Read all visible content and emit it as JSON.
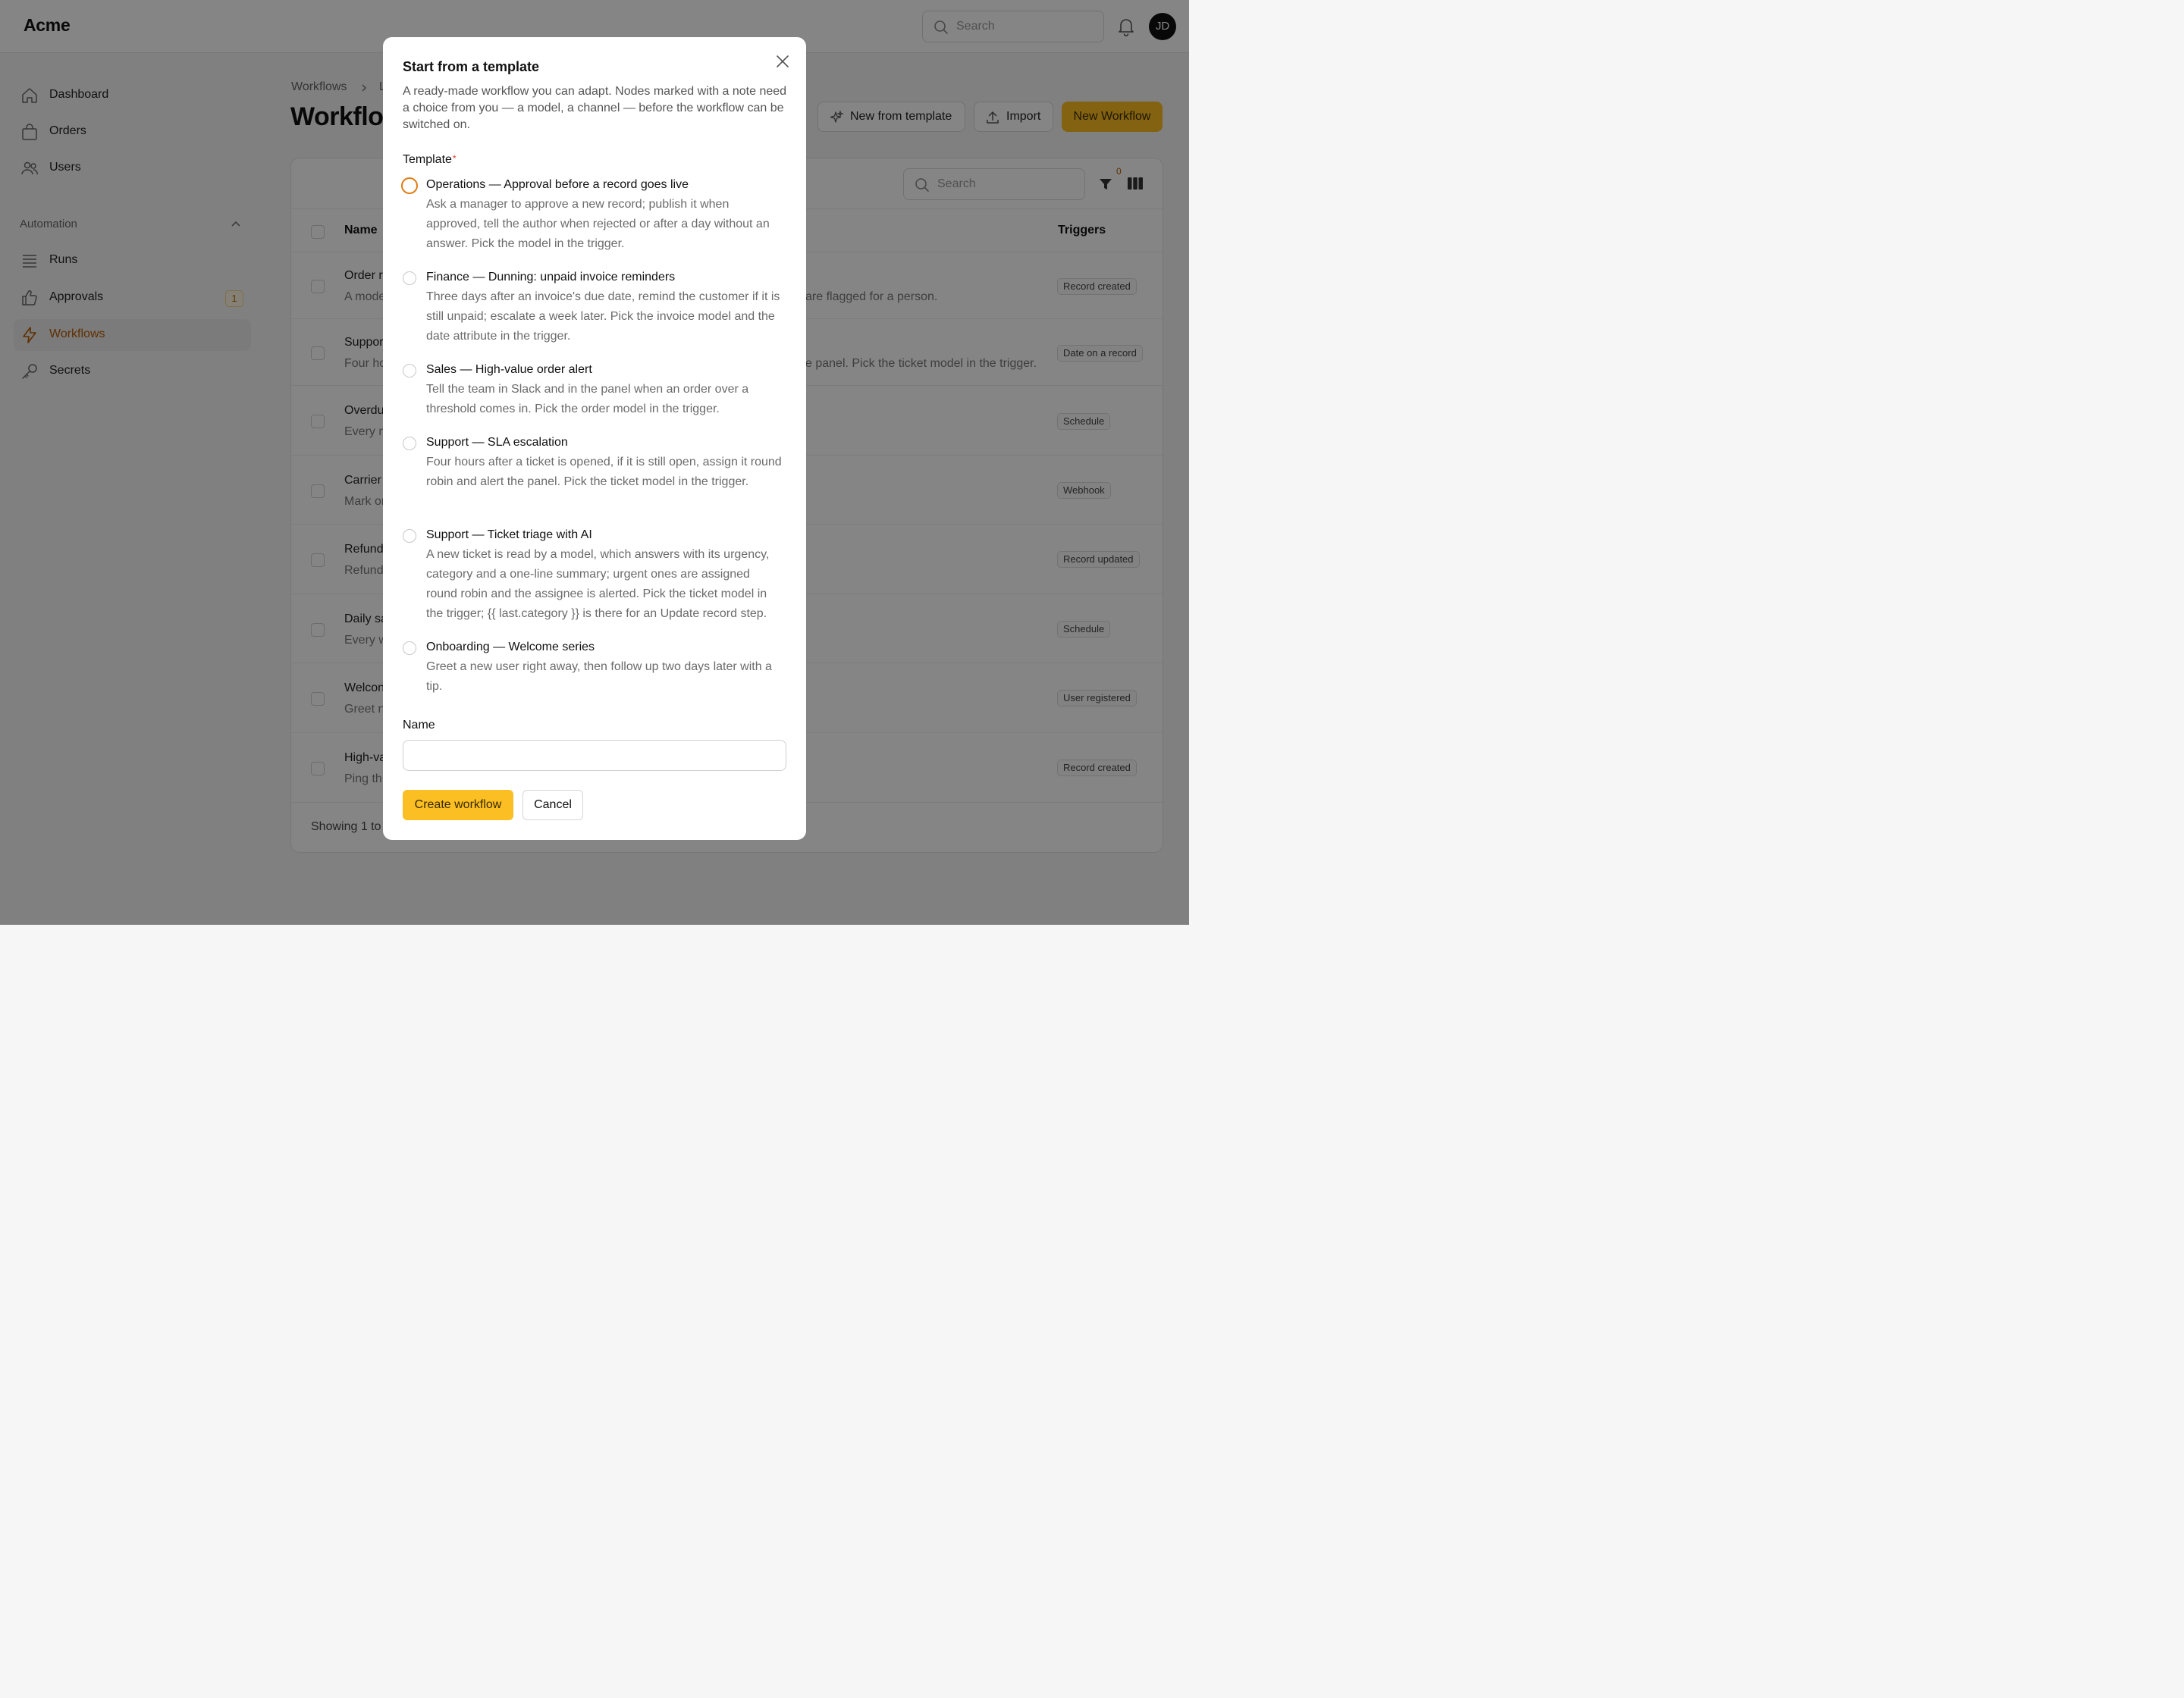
{
  "app": {
    "logo": "Acme"
  },
  "topbar": {
    "search_placeholder": "Search",
    "avatar_initials": "JD"
  },
  "sidebar": {
    "items": [
      {
        "label": "Dashboard",
        "icon": "home-icon"
      },
      {
        "label": "Orders",
        "icon": "shopping-bag-icon"
      },
      {
        "label": "Users",
        "icon": "users-icon"
      }
    ],
    "section": {
      "label": "Automation"
    },
    "automation_items": [
      {
        "label": "Runs",
        "icon": "list-icon"
      },
      {
        "label": "Approvals",
        "icon": "thumbs-up-icon",
        "badge": "1"
      },
      {
        "label": "Workflows",
        "icon": "lightning-icon",
        "active": true
      },
      {
        "label": "Secrets",
        "icon": "key-icon"
      }
    ]
  },
  "main": {
    "breadcrumb": [
      "Workflows",
      "L"
    ],
    "title": "Workflo",
    "buttons": {
      "new_from_template": "New from template",
      "import": "Import",
      "new_workflow": "New Workflow"
    },
    "table": {
      "search_placeholder": "Search",
      "filter_count": "0",
      "headers": {
        "name": "Name",
        "triggers": "Triggers"
      },
      "rows": [
        {
          "name": "Order r",
          "desc": "A mode",
          "desc_tail": "are flagged for a person.",
          "trigger": "Record created"
        },
        {
          "name": "Suppor",
          "desc": "Four ho",
          "desc_tail": "e panel. Pick the ticket model in the trigger.",
          "trigger": "Date on a record"
        },
        {
          "name": "Overdu",
          "desc": "Every n",
          "desc_tail": "",
          "trigger": "Schedule"
        },
        {
          "name": "Carrier",
          "desc": "Mark or",
          "desc_tail": "",
          "trigger": "Webhook"
        },
        {
          "name": "Refund",
          "desc": "Refund",
          "desc_tail": "",
          "trigger": "Record updated"
        },
        {
          "name": "Daily sa",
          "desc": "Every w",
          "desc_tail": "",
          "trigger": "Schedule"
        },
        {
          "name": "Welcon",
          "desc": "Greet n",
          "desc_tail": "",
          "trigger": "User registered"
        },
        {
          "name": "High-va",
          "desc": "Ping th",
          "desc_tail": "",
          "trigger": "Record created"
        }
      ],
      "showing": "Showing 1 to"
    }
  },
  "modal": {
    "title": "Start from a template",
    "description": "A ready-made workflow you can adapt. Nodes marked with a note need a choice from you — a model, a channel — before the workflow can be switched on.",
    "template_label": "Template",
    "required_mark": "*",
    "options": [
      {
        "title": "Operations — Approval before a record goes live",
        "desc": "Ask a manager to approve a new record; publish it when approved, tell the author when rejected or after a day without an answer. Pick the model in the trigger."
      },
      {
        "title": "Finance — Dunning: unpaid invoice reminders",
        "desc": "Three days after an invoice's due date, remind the customer if it is still unpaid; escalate a week later. Pick the invoice model and the date attribute in the trigger."
      },
      {
        "title": "Sales — High-value order alert",
        "desc": "Tell the team in Slack and in the panel when an order over a threshold comes in. Pick the order model in the trigger."
      },
      {
        "title": "Support — SLA escalation",
        "desc": "Four hours after a ticket is opened, if it is still open, assign it round robin and alert the panel. Pick the ticket model in the trigger."
      },
      {
        "title": "Support — Ticket triage with AI",
        "desc": "A new ticket is read by a model, which answers with its urgency, category and a one-line summary; urgent ones are assigned round robin and the assignee is alerted. Pick the ticket model in the trigger; {{ last.category }} is there for an Update record step."
      },
      {
        "title": "Onboarding — Welcome series",
        "desc": "Greet a new user right away, then follow up two days later with a tip."
      }
    ],
    "name_label": "Name",
    "name_value": "",
    "create_label": "Create workflow",
    "cancel_label": "Cancel"
  }
}
